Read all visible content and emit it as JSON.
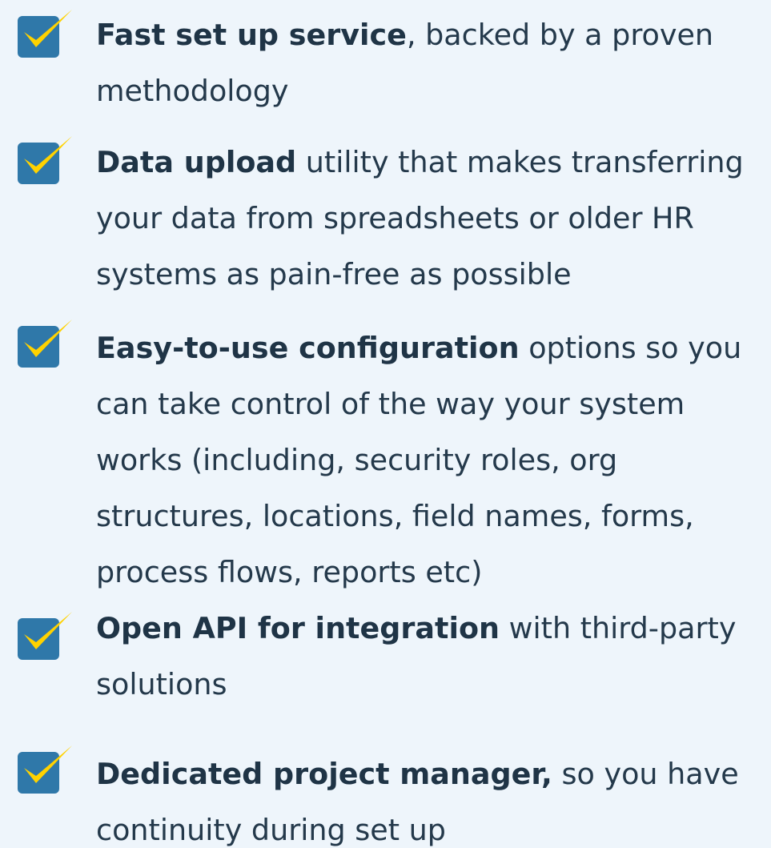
{
  "features": [
    {
      "bold": "Fast set up service",
      "text": ", backed by a proven methodology"
    },
    {
      "bold": "Data upload",
      "text": " utility that makes transferring your data from spreadsheets or older HR systems as pain-free as possible"
    },
    {
      "bold": "Easy-to-use configuration",
      "text": " options so you can take control of the way your system works (including, security roles, org structures, locations, field names, forms, process flows, reports etc)"
    },
    {
      "bold": "Open API for integration",
      "text": " with third-party solutions"
    },
    {
      "bold": "Dedicated project manager,",
      "text": " so you have continuity during set up"
    }
  ],
  "icon": "checkbox-checked-icon",
  "colors": {
    "background": "#eef5fb",
    "checkbox": "#2f78a9",
    "checkmark": "#ffd200",
    "text": "#223a4d"
  }
}
